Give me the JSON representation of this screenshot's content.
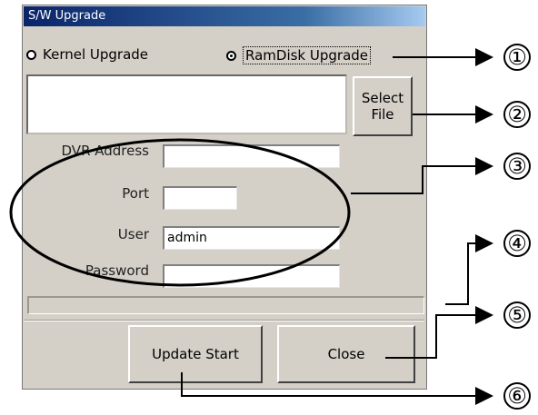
{
  "dialog": {
    "title": "S/W Upgrade",
    "radio_kernel": "Kernel Upgrade",
    "radio_ramdisk": "RamDisk Upgrade",
    "select_file_line1": "Select",
    "select_file_line2": "File",
    "dvr_address_label": "DVR Address",
    "dvr_address_value": "",
    "port_label": "Port",
    "port_value": "",
    "user_label": "User",
    "user_value": "admin",
    "password_label": "Password",
    "password_value": "",
    "update_start_label": "Update Start",
    "close_label": "Close"
  },
  "callouts": [
    "①",
    "②",
    "③",
    "④",
    "⑤",
    "⑥"
  ]
}
